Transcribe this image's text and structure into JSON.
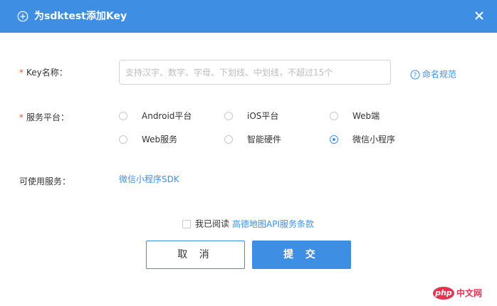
{
  "header": {
    "title": "为sdktest添加Key",
    "icon": "plus-circle-icon",
    "close_icon": "close-icon",
    "color": "#3e8fe3"
  },
  "form": {
    "required_mark": "*",
    "key_name_label": "Key名称：",
    "key_name_placeholder": "支持汉字、数字、字母、下划线、中划线，不超过15个",
    "key_name_value": "",
    "help_label": "命名规范",
    "platform_label": "服务平台：",
    "platforms": [
      {
        "label": "Android平台",
        "checked": false
      },
      {
        "label": "iOS平台",
        "checked": false
      },
      {
        "label": "Web端",
        "checked": false
      },
      {
        "label": "Web服务",
        "checked": false
      },
      {
        "label": "智能硬件",
        "checked": false
      },
      {
        "label": "微信小程序",
        "checked": true
      }
    ],
    "services_label": "可使用服务：",
    "services_value": "微信小程序SDK"
  },
  "agreement": {
    "checked": false,
    "text": "我已阅读",
    "link": "高德地图API服务条款"
  },
  "buttons": {
    "cancel": "取 消",
    "submit": "提 交"
  },
  "watermark": {
    "logo": "php",
    "text": "中文网"
  }
}
